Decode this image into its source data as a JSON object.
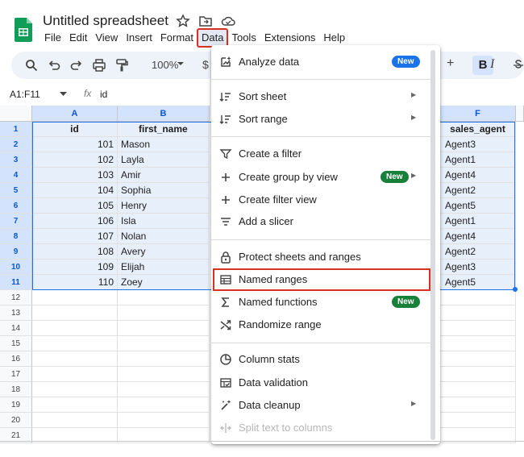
{
  "header": {
    "doc_title": "Untitled spreadsheet",
    "menus": [
      "File",
      "Edit",
      "View",
      "Insert",
      "Format",
      "Data",
      "Tools",
      "Extensions",
      "Help"
    ],
    "active_menu": "Data"
  },
  "toolbar": {
    "zoom": "100%",
    "currency": "$",
    "plus": "+",
    "bold": "B",
    "italic": "I"
  },
  "formula_bar": {
    "name_box": "A1:F11",
    "fx": "fx",
    "value": "id"
  },
  "grid": {
    "columns": [
      "A",
      "B",
      "F"
    ],
    "row_numbers": [
      "1",
      "2",
      "3",
      "4",
      "5",
      "6",
      "7",
      "8",
      "9",
      "10",
      "11",
      "12",
      "13",
      "14",
      "15",
      "16",
      "17",
      "18",
      "19",
      "20",
      "21"
    ],
    "headers": {
      "id": "id",
      "first_name": "first_name",
      "sales_agent": "sales_agent"
    },
    "rows": [
      {
        "id": "101",
        "first_name": "Mason",
        "sales_agent": "Agent3"
      },
      {
        "id": "102",
        "first_name": "Layla",
        "sales_agent": "Agent1"
      },
      {
        "id": "103",
        "first_name": "Amir",
        "sales_agent": "Agent4"
      },
      {
        "id": "104",
        "first_name": "Sophia",
        "sales_agent": "Agent2"
      },
      {
        "id": "105",
        "first_name": "Henry",
        "sales_agent": "Agent5"
      },
      {
        "id": "106",
        "first_name": "Isla",
        "sales_agent": "Agent1"
      },
      {
        "id": "107",
        "first_name": "Nolan",
        "sales_agent": "Agent4"
      },
      {
        "id": "108",
        "first_name": "Avery",
        "sales_agent": "Agent2"
      },
      {
        "id": "109",
        "first_name": "Elijah",
        "sales_agent": "Agent3"
      },
      {
        "id": "110",
        "first_name": "Zoey",
        "sales_agent": "Agent5"
      }
    ]
  },
  "data_menu": {
    "items": [
      {
        "label": "Analyze data",
        "icon": "analyze-data-icon",
        "badge": "New",
        "badge_color": "#1a73e8"
      },
      {
        "label": "Sort sheet",
        "icon": "sort-icon",
        "submenu": true
      },
      {
        "label": "Sort range",
        "icon": "sort-icon",
        "submenu": true
      },
      {
        "label": "Create a filter",
        "icon": "filter-icon"
      },
      {
        "label": "Create group by view",
        "icon": "plus-icon",
        "badge": "New",
        "badge_color": "#188038",
        "submenu": true
      },
      {
        "label": "Create filter view",
        "icon": "plus-icon"
      },
      {
        "label": "Add a slicer",
        "icon": "slicer-icon"
      },
      {
        "label": "Protect sheets and ranges",
        "icon": "lock-icon"
      },
      {
        "label": "Named ranges",
        "icon": "table-icon",
        "highlighted": true
      },
      {
        "label": "Named functions",
        "icon": "sigma-icon",
        "badge": "New",
        "badge_color": "#188038"
      },
      {
        "label": "Randomize range",
        "icon": "shuffle-icon"
      },
      {
        "label": "Column stats",
        "icon": "column-stats-icon"
      },
      {
        "label": "Data validation",
        "icon": "data-validation-icon"
      },
      {
        "label": "Data cleanup",
        "icon": "magic-wand-icon",
        "submenu": true
      },
      {
        "label": "Split text to columns",
        "icon": "split-icon",
        "disabled": true
      }
    ]
  }
}
